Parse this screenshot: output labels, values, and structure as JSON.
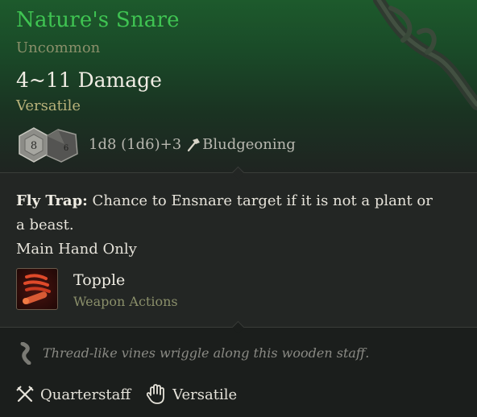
{
  "item": {
    "name": "Nature's Snare",
    "rarity": "Uncommon",
    "damage": "4~11 Damage",
    "property": "Versatile",
    "dice": {
      "die1": "8",
      "die2": "6",
      "text": "1d8 (1d6)+3",
      "damage_type": "Bludgeoning",
      "icon": "hammer-icon"
    }
  },
  "passive": {
    "name": "Fly Trap:",
    "description": "Chance to Ensnare target if it is not a plant or a beast."
  },
  "restriction": "Main Hand Only",
  "action": {
    "name": "Topple",
    "type": "Weapon Actions",
    "icon": "topple-icon"
  },
  "flavor": {
    "text": "Thread-like vines wriggle along this wooden staff.",
    "icon": "scroll-icon"
  },
  "tags": [
    {
      "label": "Quarterstaff",
      "icon": "crossed-staff-icon"
    },
    {
      "label": "Versatile",
      "icon": "hand-icon"
    }
  ],
  "colors": {
    "title": "#3fc452",
    "header_green": "#1d5a2c",
    "muted": "#8a8f6a",
    "text": "#e6e3da"
  }
}
